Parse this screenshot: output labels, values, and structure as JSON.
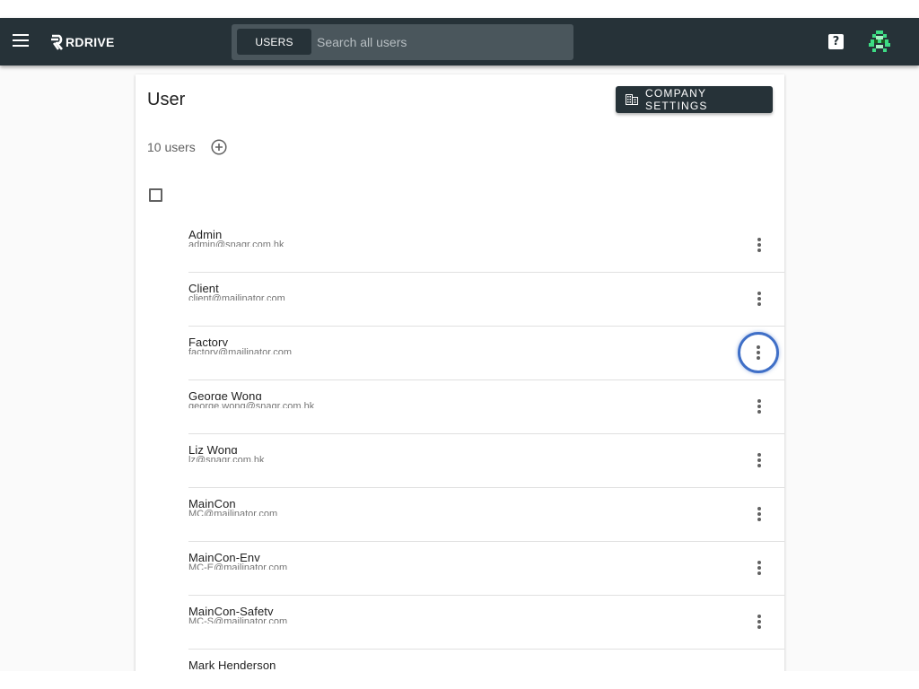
{
  "app": {
    "brand": "RDRIVE",
    "search": {
      "scope_label": "USERS",
      "placeholder": "Search all users",
      "value": ""
    },
    "help_icon": "help-icon",
    "avatar_icon": "pixel-avatar-icon"
  },
  "page": {
    "title": "User",
    "company_settings_label": "COMPANY SETTINGS",
    "user_count": "10 users"
  },
  "users": [
    {
      "name": "Admin",
      "email": "admin@snagr.com.hk"
    },
    {
      "name": "Client",
      "email": "client@mailinator.com"
    },
    {
      "name": "Factory",
      "email": "factory@mailinator.com"
    },
    {
      "name": "George Wong",
      "email": "george.wong@snagr.com.hk"
    },
    {
      "name": "Liz Wong",
      "email": "lz@snagr.com.hk"
    },
    {
      "name": "MainCon",
      "email": "MC@mailinator.com"
    },
    {
      "name": "MainCon-Env",
      "email": "MC-E@mailinator.com"
    },
    {
      "name": "MainCon-Safety",
      "email": "MC-S@mailinator.com"
    },
    {
      "name": "Mark Henderson",
      "email": ""
    }
  ],
  "colors": {
    "appbar": "#263238",
    "focus_ring": "#3f6fc7",
    "avatar_green": "#3ddc84"
  }
}
